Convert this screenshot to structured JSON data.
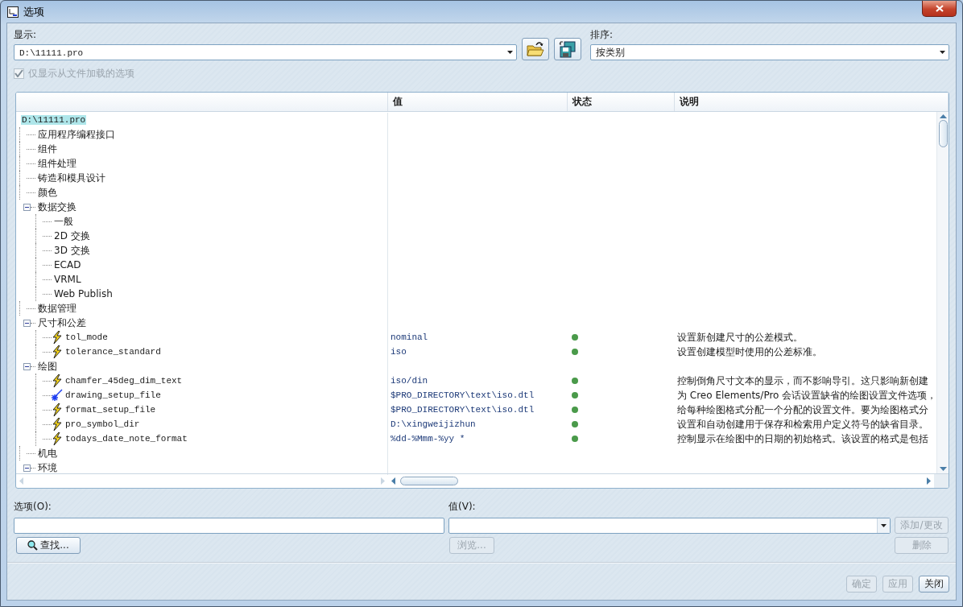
{
  "window": {
    "title": "选项"
  },
  "display": {
    "label": "显示:",
    "value": "D:\\11111.pro"
  },
  "sort": {
    "label": "排序:",
    "value": "按类别"
  },
  "filter": {
    "label": "仅显示从文件加载的选项",
    "checked": true,
    "disabled": true
  },
  "table": {
    "columns": [
      "值",
      "状态",
      "说明"
    ],
    "tree": {
      "label": "D:\\11111.pro",
      "selected": true,
      "children": [
        {
          "kind": "category",
          "label": "应用程序编程接口"
        },
        {
          "kind": "category",
          "label": "组件"
        },
        {
          "kind": "category",
          "label": "组件处理"
        },
        {
          "kind": "category",
          "label": "铸造和模具设计"
        },
        {
          "kind": "category",
          "label": "颜色"
        },
        {
          "kind": "category",
          "label": "数据交换",
          "expanded": true,
          "children": [
            {
              "kind": "category",
              "label": "一般"
            },
            {
              "kind": "category",
              "label": "2D 交换"
            },
            {
              "kind": "category",
              "label": "3D 交换"
            },
            {
              "kind": "category",
              "label": "ECAD"
            },
            {
              "kind": "category",
              "label": "VRML"
            },
            {
              "kind": "category",
              "label": "Web Publish"
            }
          ]
        },
        {
          "kind": "category",
          "label": "数据管理"
        },
        {
          "kind": "category",
          "label": "尺寸和公差",
          "expanded": true,
          "children": [
            {
              "kind": "option",
              "label": "tol_mode",
              "value": "nominal",
              "description": "设置新创建尺寸的公差模式。"
            },
            {
              "kind": "option",
              "label": "tolerance_standard",
              "value": "iso",
              "description": "设置创建模型时使用的公差标准。"
            }
          ]
        },
        {
          "kind": "category",
          "label": "绘图",
          "expanded": true,
          "children": [
            {
              "kind": "option",
              "label": "chamfer_45deg_dim_text",
              "value": "iso/din",
              "description": "控制倒角尺寸文本的显示，而不影响导引。这只影响新创建"
            },
            {
              "kind": "option_changed",
              "label": "drawing_setup_file",
              "value": "$PRO_DIRECTORY\\text\\iso.dtl",
              "description": "为 Creo Elements/Pro 会话设置缺省的绘图设置文件选项，"
            },
            {
              "kind": "option",
              "label": "format_setup_file",
              "value": "$PRO_DIRECTORY\\text\\iso.dtl",
              "description": "给每种绘图格式分配一个分配的设置文件。要为绘图格式分"
            },
            {
              "kind": "option",
              "label": "pro_symbol_dir",
              "value": "D:\\xingweijizhun",
              "description": "设置和自动创建用于保存和检索用户定义符号的缺省目录。"
            },
            {
              "kind": "option",
              "label": "todays_date_note_format",
              "value": "%dd-%Mmm-%yy *",
              "description": "控制显示在绘图中的日期的初始格式。该设置的格式是包括"
            }
          ]
        },
        {
          "kind": "category",
          "label": "机电"
        },
        {
          "kind": "category",
          "label": "环境",
          "expanded": true
        }
      ]
    }
  },
  "option_field": {
    "label": "选项(O):"
  },
  "value_field": {
    "label": "值(V):"
  },
  "find_button": {
    "label": "查找..."
  },
  "browse_button": {
    "label": "浏览...",
    "disabled": true
  },
  "add_button": {
    "label": "添加/更改",
    "disabled": true
  },
  "delete_button": {
    "label": "删除",
    "disabled": true
  },
  "footer_buttons": [
    {
      "label": "确定",
      "disabled": true
    },
    {
      "label": "应用",
      "disabled": true
    },
    {
      "label": "关闭",
      "disabled": false
    }
  ]
}
